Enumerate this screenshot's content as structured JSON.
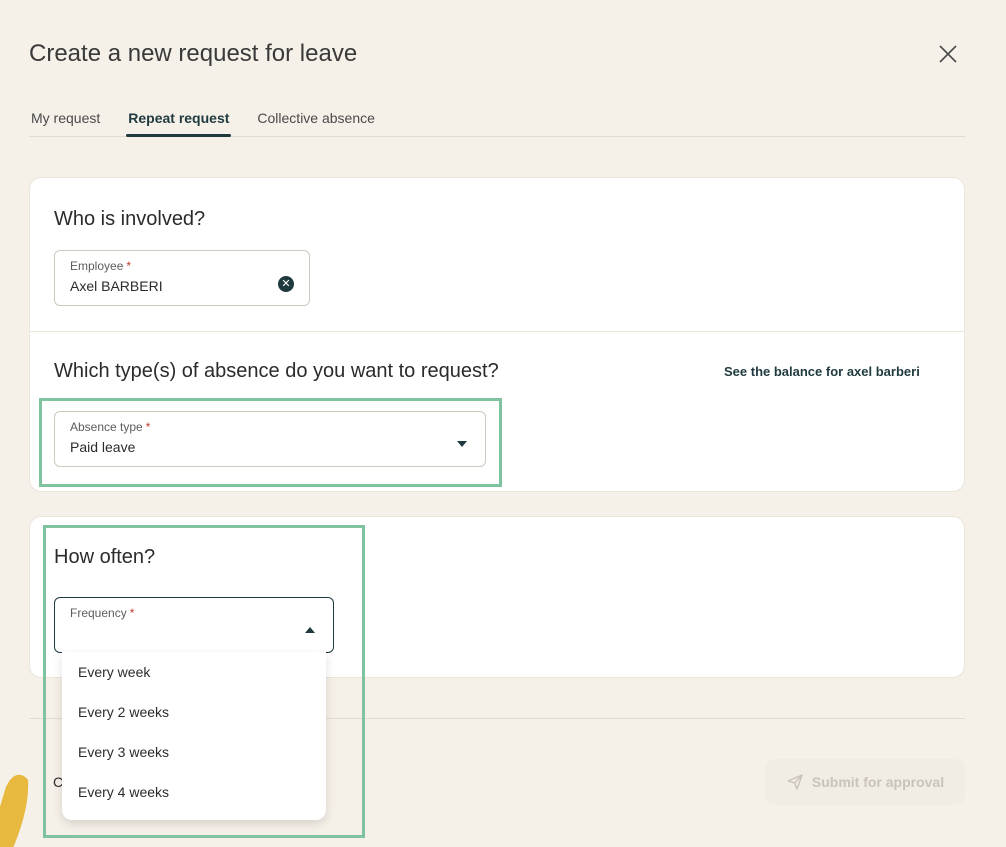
{
  "dialog": {
    "title": "Create a new request for leave",
    "close_icon": "close-icon"
  },
  "tabs": [
    {
      "label": "My request",
      "active": false
    },
    {
      "label": "Repeat request",
      "active": true
    },
    {
      "label": "Collective absence",
      "active": false
    }
  ],
  "involved": {
    "title": "Who is involved?",
    "employee_label": "Employee",
    "employee_required": "*",
    "employee_value": "Axel BARBERI",
    "clear_icon": "clear-circle-icon"
  },
  "absence": {
    "title": "Which type(s) of absence do you want to request?",
    "balance_link": "See the balance for axel barberi",
    "type_label": "Absence type",
    "type_required": "*",
    "type_value": "Paid leave"
  },
  "frequency": {
    "title": "How often?",
    "label": "Frequency",
    "required": "*",
    "value": "",
    "options": [
      "Every week",
      "Every 2 weeks",
      "Every 3 weeks",
      "Every 4 weeks"
    ]
  },
  "footer": {
    "cancel_partial": "C",
    "submit_label": "Submit for approval",
    "submit_icon": "send-icon"
  },
  "colors": {
    "accent": "#1f3a3f",
    "highlight": "#7fc3a0",
    "background": "#f5f0e8",
    "blob": "#e8b93f"
  }
}
